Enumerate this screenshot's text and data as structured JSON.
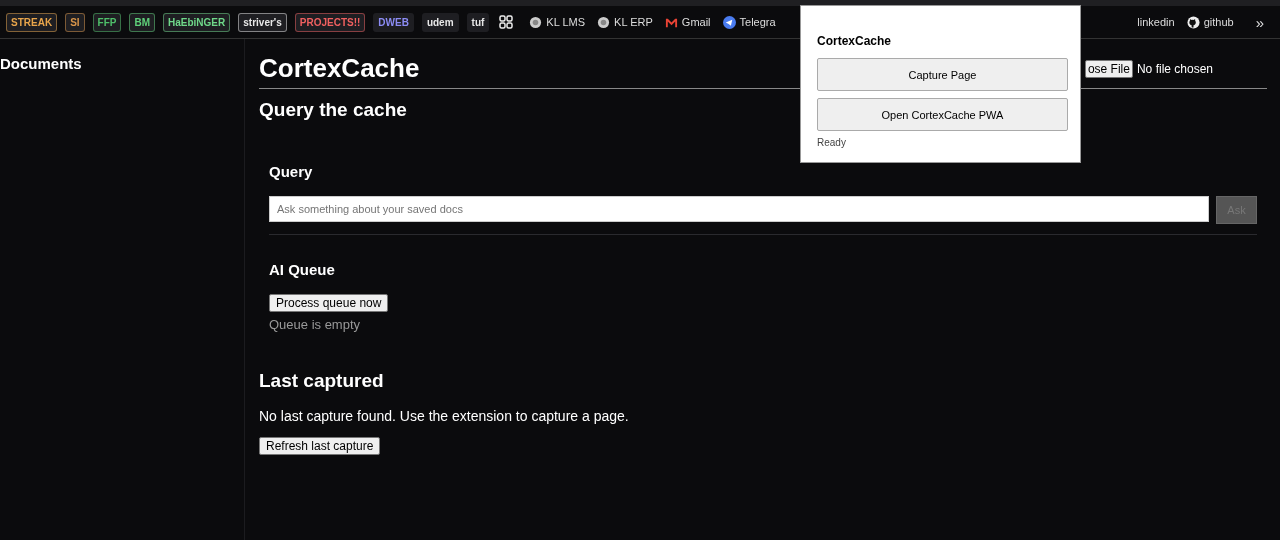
{
  "bookmarks": [
    {
      "kind": "chip",
      "label": "STREAK",
      "color": "#e8a54b"
    },
    {
      "kind": "chip",
      "label": "SI",
      "color": "#d9954a"
    },
    {
      "kind": "chip",
      "label": "FFP",
      "color": "#4fbf6a"
    },
    {
      "kind": "chip",
      "label": "BM",
      "color": "#5fd07a"
    },
    {
      "kind": "chip",
      "label": "HaEbiNGER",
      "color": "#6fd88a"
    },
    {
      "kind": "chip",
      "label": "striver's",
      "color": "#e8e8e8"
    },
    {
      "kind": "chip",
      "label": "PROJECTS!!",
      "color": "#f06060"
    },
    {
      "kind": "chip",
      "label": "DWEB",
      "color": "#8c8cf5"
    },
    {
      "kind": "chip",
      "label": "udem",
      "color": "#e8e8e8"
    },
    {
      "kind": "chip",
      "label": "tuf",
      "color": "#e8e8e8"
    },
    {
      "kind": "apps"
    },
    {
      "kind": "site",
      "label": "KL LMS"
    },
    {
      "kind": "site",
      "label": "KL ERP"
    },
    {
      "kind": "mail",
      "label": "Gmail"
    },
    {
      "kind": "chat",
      "label": "Telegra"
    },
    {
      "kind": "spacer"
    },
    {
      "kind": "plain",
      "label": "linkedin"
    },
    {
      "kind": "code",
      "label": "github"
    }
  ],
  "bookmarks_more": "»",
  "sidebar": {
    "title": "Documents"
  },
  "page": {
    "title": "CortexCache",
    "file_button": "ose File",
    "file_status": "No file chosen",
    "section_title": "Query the cache"
  },
  "query": {
    "title": "Query",
    "placeholder": "Ask something about your saved docs",
    "ask_button": "Ask",
    "ask_disabled": true
  },
  "ai_queue": {
    "title": "AI Queue",
    "button": "Process queue now",
    "status": "Queue is empty"
  },
  "last_captured": {
    "title": "Last captured",
    "message": "No last capture found. Use the extension to capture a page.",
    "button": "Refresh last capture"
  },
  "popup": {
    "title": "CortexCache",
    "buttons": [
      "Capture Page",
      "Open CortexCache PWA"
    ],
    "status": "Ready"
  }
}
